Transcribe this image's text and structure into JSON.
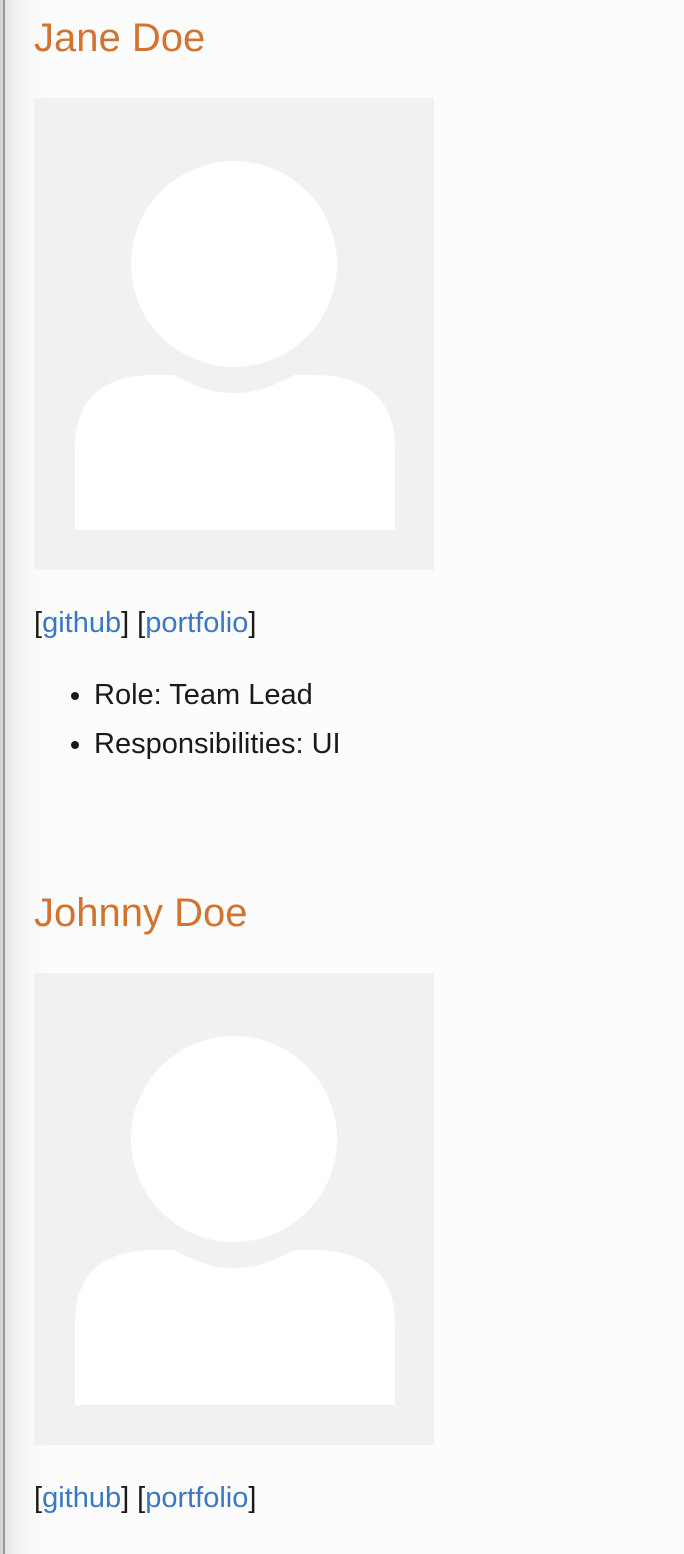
{
  "members": [
    {
      "name": "Jane Doe",
      "links": [
        "github",
        "portfolio"
      ],
      "details": [
        "Role: Team Lead",
        "Responsibilities: UI"
      ]
    },
    {
      "name": "Johnny Doe",
      "links": [
        "github",
        "portfolio"
      ]
    }
  ],
  "colors": {
    "name": "#d2742f",
    "link": "#3b78c4",
    "avatar_bg": "#f1f1f1"
  },
  "icons": [
    "avatar-placeholder-icon"
  ]
}
